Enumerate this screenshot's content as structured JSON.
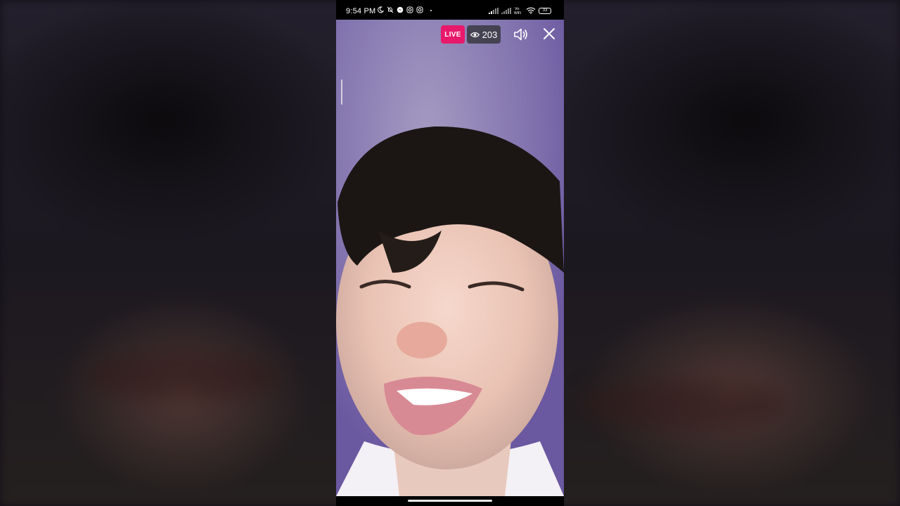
{
  "status_bar": {
    "time": "9:54 PM",
    "battery": "33",
    "icons": [
      "moon-icon",
      "bell-off-icon",
      "messenger-icon",
      "instagram-icon",
      "instagram-icon",
      "dot-icon",
      "signal-icon",
      "signal-icon",
      "vowifi-icon",
      "wifi-icon",
      "battery-icon"
    ],
    "vowifi_label": "Vo WiFi"
  },
  "live": {
    "badge_label": "LIVE",
    "viewer_count": "203",
    "viewer_icon": "eye-icon",
    "sound_icon": "speaker-icon",
    "close_icon": "close-icon"
  },
  "colors": {
    "live_badge": "#e8196b",
    "viewer_badge_bg": "#323237",
    "video_background": "#7d6aa6"
  }
}
